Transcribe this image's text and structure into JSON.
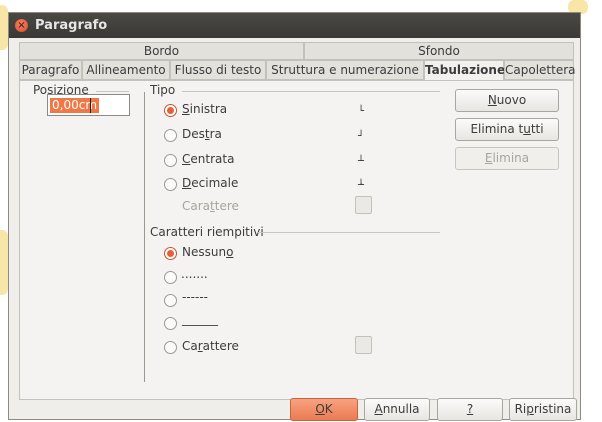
{
  "window": {
    "title": "Paragrafo"
  },
  "tabs_top": [
    "Bordo",
    "Sfondo"
  ],
  "tabs": [
    "Paragrafo",
    "Allineamento",
    "Flusso di testo",
    "Struttura e numerazione",
    "Tabulazione",
    "Capolettera"
  ],
  "active_tab": "Tabulazione",
  "position": {
    "label": "Posizione",
    "value": "0,00cm"
  },
  "type": {
    "label": "Tipo",
    "options": [
      {
        "label": "Sinistra",
        "checked": true,
        "glyph": "└"
      },
      {
        "label": "Destra",
        "checked": false,
        "glyph": "┘"
      },
      {
        "label": "Centrata",
        "checked": false,
        "glyph": "┴"
      },
      {
        "label": "Decimale",
        "checked": false,
        "glyph": "┴"
      }
    ],
    "character_label": "Carattere"
  },
  "fill": {
    "label": "Caratteri riempitivi",
    "options": [
      {
        "label": "Nessuno",
        "checked": true
      },
      {
        "label": ".......",
        "checked": false
      },
      {
        "label": "------",
        "checked": false
      },
      {
        "label": "______",
        "checked": false
      },
      {
        "label": "Carattere",
        "checked": false
      }
    ]
  },
  "side_buttons": [
    "Nuovo",
    "Elimina tutti",
    "Elimina"
  ],
  "footer_buttons": [
    "OK",
    "Annulla",
    "?",
    "Ripristina"
  ],
  "colors": {
    "accent": "#e5603a",
    "title_bar": "#3f3e3a"
  }
}
